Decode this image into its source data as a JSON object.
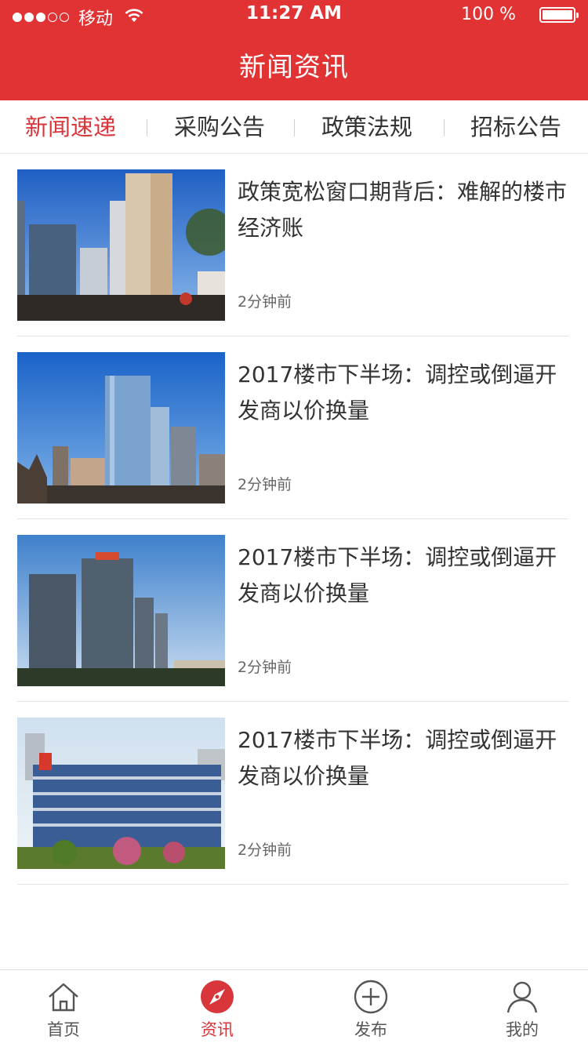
{
  "status_bar": {
    "carrier": "移动",
    "time": "11:27 AM",
    "battery": "100 %",
    "battery_level": 1.0,
    "signal_filled": 3,
    "signal_total": 5
  },
  "header": {
    "title": "新闻资讯"
  },
  "category_tabs": [
    {
      "label": "新闻速递",
      "active": true
    },
    {
      "label": "采购公告",
      "active": false
    },
    {
      "label": "政策法规",
      "active": false
    },
    {
      "label": "招标公告",
      "active": false
    }
  ],
  "news": [
    {
      "title": "政策宽松窗口期背后：难解的楼市经济账",
      "time": "2分钟前",
      "image": "city-buildings-photo"
    },
    {
      "title": "2017楼市下半场：调控或倒逼开发商以价换量",
      "time": "2分钟前",
      "image": "glass-tower-photo"
    },
    {
      "title": "2017楼市下半场：调控或倒逼开发商以价换量",
      "time": "2分钟前",
      "image": "highrise-photo"
    },
    {
      "title": "2017楼市下半场：调控或倒逼开发商以价换量",
      "time": "2分钟前",
      "image": "shopping-mall-photo"
    }
  ],
  "tabbar": [
    {
      "label": "首页",
      "icon": "home-icon",
      "active": false
    },
    {
      "label": "资讯",
      "icon": "compass-icon",
      "active": true
    },
    {
      "label": "发布",
      "icon": "plus-circle-icon",
      "active": false
    },
    {
      "label": "我的",
      "icon": "user-icon",
      "active": false
    }
  ],
  "colors": {
    "brand_red": "#e13234",
    "active_text": "#d9363b",
    "divider": "#e3e3e3"
  }
}
